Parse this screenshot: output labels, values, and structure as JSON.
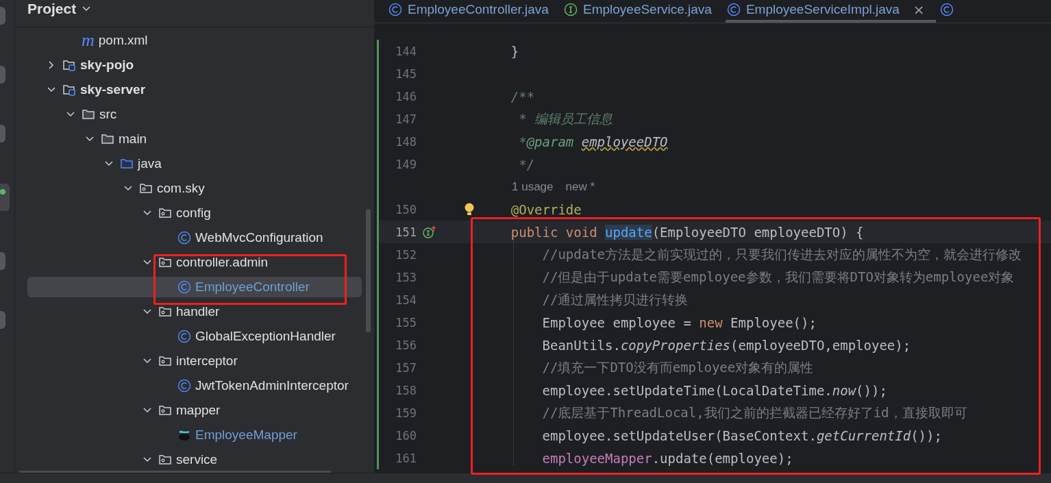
{
  "project_panel": {
    "title": "Project",
    "tree": [
      {
        "children": [
          {
            "name": "pom.xml",
            "kind": "maven",
            "glyph": "m",
            "modified": false,
            "selected": false
          }
        ]
      },
      {
        "name": "sky-pojo",
        "kind": "module",
        "expanded": false,
        "modified": false,
        "selected": false
      },
      {
        "name": "sky-server",
        "kind": "module",
        "expanded": true,
        "modified": false,
        "selected": false,
        "children": [
          {
            "name": "src",
            "kind": "folder",
            "expanded": true,
            "modified": false,
            "selected": false,
            "children": [
              {
                "name": "main",
                "kind": "folder",
                "expanded": true,
                "modified": false,
                "selected": false,
                "children": [
                  {
                    "name": "java",
                    "kind": "source",
                    "expanded": true,
                    "modified": false,
                    "selected": false,
                    "children": [
                      {
                        "name": "com.sky",
                        "kind": "package",
                        "expanded": true,
                        "modified": false,
                        "selected": false,
                        "children": [
                          {
                            "name": "config",
                            "kind": "package",
                            "expanded": true,
                            "modified": false,
                            "selected": false,
                            "children": [
                              {
                                "name": "WebMvcConfiguration",
                                "kind": "class",
                                "modified": false,
                                "selected": false
                              }
                            ]
                          },
                          {
                            "name": "controller.admin",
                            "kind": "package",
                            "expanded": true,
                            "modified": false,
                            "selected": false,
                            "children": [
                              {
                                "name": "EmployeeController",
                                "kind": "class",
                                "modified": true,
                                "selected": true
                              }
                            ]
                          },
                          {
                            "name": "handler",
                            "kind": "package",
                            "expanded": true,
                            "modified": false,
                            "selected": false,
                            "children": [
                              {
                                "name": "GlobalExceptionHandler",
                                "kind": "class",
                                "modified": false,
                                "selected": false
                              }
                            ]
                          },
                          {
                            "name": "interceptor",
                            "kind": "package",
                            "expanded": true,
                            "modified": false,
                            "selected": false,
                            "children": [
                              {
                                "name": "JwtTokenAdminInterceptor",
                                "kind": "class",
                                "modified": false,
                                "selected": false
                              }
                            ]
                          },
                          {
                            "name": "mapper",
                            "kind": "package",
                            "expanded": true,
                            "modified": false,
                            "selected": false,
                            "children": [
                              {
                                "name": "EmployeeMapper",
                                "kind": "mapper",
                                "modified": true,
                                "selected": false
                              }
                            ]
                          },
                          {
                            "name": "service",
                            "kind": "package",
                            "expanded": true,
                            "modified": false,
                            "selected": false
                          }
                        ]
                      }
                    ]
                  }
                ]
              }
            ]
          }
        ]
      }
    ]
  },
  "editor": {
    "tabs": [
      {
        "label": "EmployeeController.java",
        "kind": "class",
        "selected": false,
        "closable": false
      },
      {
        "label": "EmployeeService.java",
        "kind": "interface",
        "selected": false,
        "closable": false
      },
      {
        "label": "EmployeeServiceImpl.java",
        "kind": "class",
        "selected": true,
        "closable": true,
        "close": "×"
      },
      {
        "kind": "class",
        "selected": false,
        "closable": false
      }
    ],
    "lines": [
      {
        "kind": "code",
        "number": "144",
        "current": false,
        "bulb": false,
        "implements": false,
        "tokens": [
          {
            "kind": "plain",
            "t": "    }"
          }
        ]
      },
      {
        "kind": "code",
        "number": "145",
        "current": false,
        "bulb": false,
        "implements": false
      },
      {
        "kind": "code",
        "number": "146",
        "current": false,
        "bulb": false,
        "implements": false,
        "tokens": [
          {
            "kind": "doc",
            "t": "    /**"
          }
        ]
      },
      {
        "kind": "code",
        "number": "147",
        "current": false,
        "bulb": false,
        "implements": false,
        "tokens": [
          {
            "kind": "doc",
            "t": "     * 编辑员工信息"
          }
        ]
      },
      {
        "kind": "code",
        "number": "148",
        "current": false,
        "bulb": false,
        "implements": false,
        "tokens": [
          {
            "kind": "doc",
            "t": "     *"
          },
          {
            "kind": "doctag",
            "t": "@param"
          },
          {
            "kind": "docparam",
            "t": "employeeDTO"
          }
        ]
      },
      {
        "kind": "code",
        "number": "149",
        "current": false,
        "bulb": false,
        "implements": false,
        "tokens": [
          {
            "kind": "doc",
            "t": "     */"
          }
        ]
      },
      {
        "kind": "hint",
        "hints": [
          "1 usage",
          "new *"
        ]
      },
      {
        "kind": "code",
        "number": "150",
        "current": false,
        "bulb": true,
        "implements": false,
        "tokens": [
          {
            "kind": "annotation",
            "t": "    @Override"
          }
        ]
      },
      {
        "kind": "code",
        "number": "151",
        "current": true,
        "bulb": false,
        "implements": true,
        "tokens": [
          {
            "kind": "kw",
            "t": "    public void"
          },
          {
            "kind": "decl",
            "t": "update"
          },
          {
            "kind": "plain",
            "t": "(EmployeeDTO employeeDTO) {"
          }
        ]
      },
      {
        "kind": "code",
        "number": "152",
        "current": false,
        "bulb": false,
        "implements": false,
        "tokens": [
          {
            "kind": "comment",
            "t": "        //update方法是之前实现过的，只要我们传进去对应的属性不为空，就会进行修改"
          }
        ]
      },
      {
        "kind": "code",
        "number": "153",
        "current": false,
        "bulb": false,
        "implements": false,
        "tokens": [
          {
            "kind": "comment",
            "t": "        //但是由于update需要employee参数，我们需要将DTO对象转为employee对象"
          }
        ]
      },
      {
        "kind": "code",
        "number": "154",
        "current": false,
        "bulb": false,
        "implements": false,
        "tokens": [
          {
            "kind": "comment",
            "t": "        //通过属性拷贝进行转换"
          }
        ]
      },
      {
        "kind": "code",
        "number": "155",
        "current": false,
        "bulb": false,
        "implements": false,
        "tokens": [
          {
            "kind": "plain",
            "t": "        Employee employee ="
          },
          {
            "kind": "kw",
            "t": "new"
          },
          {
            "kind": "plain",
            "t": "Employee();"
          }
        ]
      },
      {
        "kind": "code",
        "number": "156",
        "current": false,
        "bulb": false,
        "implements": false,
        "tokens": [
          {
            "kind": "plain",
            "t": "        BeanUtils."
          },
          {
            "kind": "static",
            "t": "copyProperties"
          },
          {
            "kind": "plain",
            "t": "(employeeDTO,employee);"
          }
        ]
      },
      {
        "kind": "code",
        "number": "157",
        "current": false,
        "bulb": false,
        "implements": false,
        "tokens": [
          {
            "kind": "comment",
            "t": "        //填充一下DTO没有而employee对象有的属性"
          }
        ]
      },
      {
        "kind": "code",
        "number": "158",
        "current": false,
        "bulb": false,
        "implements": false,
        "tokens": [
          {
            "kind": "plain",
            "t": "        employee.setUpdateTime(LocalDateTime."
          },
          {
            "kind": "static",
            "t": "now"
          },
          {
            "kind": "plain",
            "t": "());"
          }
        ]
      },
      {
        "kind": "code",
        "number": "159",
        "current": false,
        "bulb": false,
        "implements": false,
        "tokens": [
          {
            "kind": "comment",
            "t": "        //底层基于ThreadLocal,我们之前的拦截器已经存好了id，直接取即可"
          }
        ]
      },
      {
        "kind": "code",
        "number": "160",
        "current": false,
        "bulb": false,
        "implements": false,
        "tokens": [
          {
            "kind": "plain",
            "t": "        employee.setUpdateUser(BaseContext."
          },
          {
            "kind": "static",
            "t": "getCurrentId"
          },
          {
            "kind": "plain",
            "t": "());"
          }
        ]
      },
      {
        "kind": "code",
        "number": "161",
        "current": false,
        "bulb": false,
        "implements": false,
        "tokens": [
          {
            "kind": "field",
            "t": "        employeeMapper"
          },
          {
            "kind": "plain",
            "t": ".update(employee);"
          }
        ]
      }
    ]
  },
  "annotations": [
    {
      "kind": "red-rectangle"
    },
    {
      "kind": "red-rectangle"
    }
  ]
}
